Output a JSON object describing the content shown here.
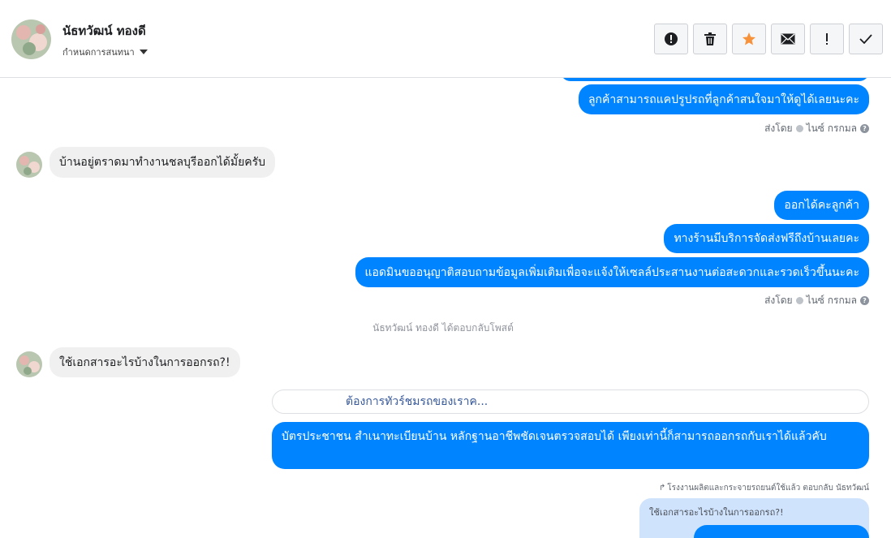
{
  "header": {
    "contact_name": "นัธทวัฒน์ ทองดี",
    "assign_label": "กำหนดการสนทนา",
    "actions": [
      "spam-icon",
      "trash-icon",
      "star-icon",
      "mail-icon",
      "important-icon",
      "check-icon"
    ],
    "star_color": "#f7923a"
  },
  "messages": {
    "out1": "ลูกค้าสามารถแคปรูปรถที่ลูกค้าสนใจมาให้ดูได้เลยนะคะ",
    "sent_by_label1": "ส่งโดย",
    "sent_by_name1": "ไนซ์ กรกมล",
    "in1": "บ้านอยู่ตราดมาทำงานชลบุรีออกได้มั้ยครับ",
    "out2": "ออกได้คะลูกค้า",
    "out3": "ทางร้านมีบริการจัดส่งฟรีถึงบ้านเลยคะ",
    "out4": "แอดมินขออนุญาติสอบถามข้อมูลเพิ่มเติมเพื่อจะแจ้งให้เซลล์ประสานงานต่อสะดวกและรวดเร็วขึ้นนะคะ",
    "sent_by_label2": "ส่งโดย",
    "sent_by_name2": "ไนซ์ กรกมล",
    "system_note": "นัธทวัฒน์ ทองดี ได้ตอบกลับโพสต์",
    "in2": "ใช้เอกสารอะไรบ้างในการออกรถ?!",
    "link_card": "ต้องการทัวร์ชมรถของเราค...",
    "out5": "บัตรประชาชน สำเนาทะเบียนบ้าน หลักฐานอาชีพชัดเจนตรวจสอบได้ เพียงเท่านี้ก็สามารถออกรถกับเราได้แล้วคับ",
    "reply_header": "โรงงานผลิตและกระจายรถยนต์ใช้แล้ว ตอบกลับ นัธทวัฒน์",
    "quoted": "ใช้เอกสารอะไรบ้างในการออกรถ?!"
  },
  "colors": {
    "bubble_out": "#0084ff",
    "bubble_in": "#f1f0f0"
  }
}
